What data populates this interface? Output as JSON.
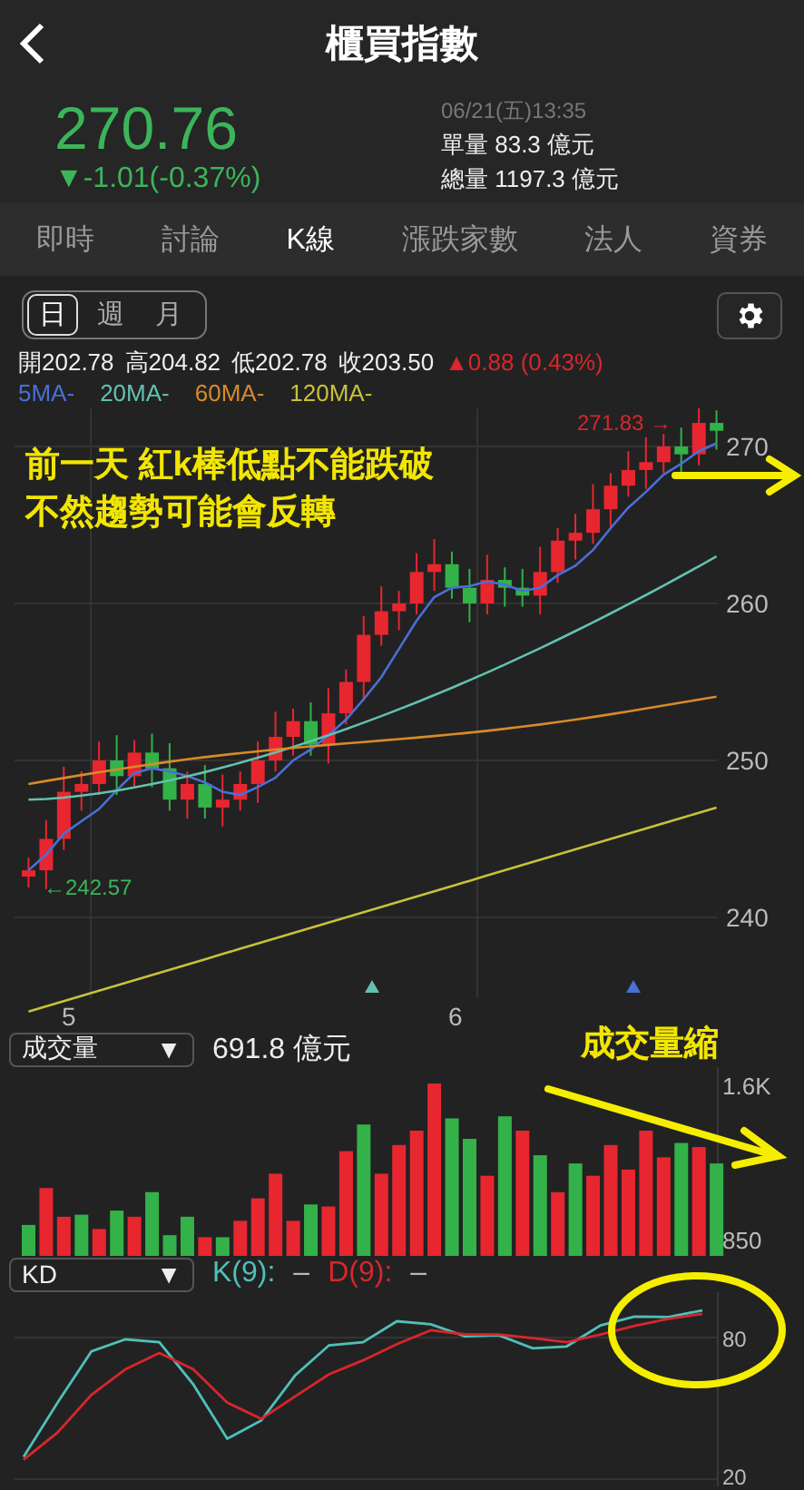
{
  "header": {
    "title": "櫃買指數"
  },
  "quote": {
    "price": "270.76",
    "change": "▼-1.01(-0.37%)",
    "time": "06/21(五)13:35",
    "volume_lines": [
      {
        "label": "單量",
        "value": "83.3 億元"
      },
      {
        "label": "總量",
        "value": "1197.3 億元"
      }
    ]
  },
  "tabs": [
    {
      "label": "即時",
      "selected": false
    },
    {
      "label": "討論",
      "selected": false
    },
    {
      "label": "K線",
      "selected": true
    },
    {
      "label": "漲跌家數",
      "selected": false
    },
    {
      "label": "法人",
      "selected": false
    },
    {
      "label": "資券",
      "selected": false
    }
  ],
  "periods": [
    {
      "label": "日",
      "selected": true
    },
    {
      "label": "週",
      "selected": false
    },
    {
      "label": "月",
      "selected": false
    }
  ],
  "ohlc": [
    {
      "label": "開",
      "value": "202.78"
    },
    {
      "label": "高",
      "value": "204.82"
    },
    {
      "label": "低",
      "value": "202.78"
    },
    {
      "label": "收",
      "value": "203.50"
    }
  ],
  "day_change": "▲0.88 (0.43%)",
  "ma_legend": [
    {
      "label": "5MA-",
      "color": "#4a6fd8"
    },
    {
      "label": "20MA-",
      "color": "#63c1b0"
    },
    {
      "label": "60MA-",
      "color": "#d88a2a"
    },
    {
      "label": "120MA-",
      "color": "#c9c13a"
    }
  ],
  "price_chart": {
    "high_label": "271.83 →",
    "low_label": "←242.57",
    "price_ticks": [
      "270",
      "260",
      "250",
      "240"
    ],
    "date_labels": [
      "5",
      "6"
    ]
  },
  "volume": {
    "selector": "成交量",
    "caret": "▼",
    "total": "691.8 億元",
    "chart_data": {
      "type": "bar",
      "stacked": true,
      "categories": [
        null,
        null,
        null,
        null,
        null,
        null,
        null,
        null,
        null,
        null,
        null,
        null,
        null,
        null,
        null,
        null,
        null,
        null,
        null,
        null,
        null,
        null,
        null,
        null,
        null,
        null,
        null,
        null,
        null,
        null,
        null,
        null,
        null,
        null,
        null,
        null,
        null,
        null,
        null,
        null
      ],
      "ylim": [
        769,
        1690
      ],
      "yticks": [
        {
          "value": 1600,
          "label": "1.6K"
        },
        {
          "value": 850,
          "label": "850"
        }
      ],
      "series": [
        {
          "color": "#e8262f",
          "values": [
            null,
            1100,
            960,
            null,
            900,
            null,
            960,
            null,
            null,
            null,
            860,
            null,
            940,
            1050,
            1170,
            940,
            null,
            1010,
            1280,
            null,
            1170,
            1310,
            1380,
            1610,
            null,
            null,
            1160,
            null,
            1380,
            null,
            1080,
            null,
            1160,
            1310,
            1190,
            1380,
            1250,
            null,
            1300,
            null
          ]
        },
        {
          "color": "#33b249",
          "values": [
            920,
            null,
            null,
            970,
            null,
            990,
            null,
            1080,
            870,
            960,
            null,
            860,
            null,
            null,
            null,
            null,
            1020,
            null,
            null,
            1410,
            null,
            null,
            null,
            null,
            1440,
            1340,
            null,
            1450,
            null,
            1260,
            null,
            1220,
            null,
            null,
            null,
            null,
            null,
            1320,
            null,
            1220
          ]
        }
      ]
    }
  },
  "kd": {
    "selector": "KD",
    "caret": "▼",
    "legend": [
      {
        "label": "K(9):",
        "value": "–",
        "color": "#4fc0b8"
      },
      {
        "label": "D(9):",
        "value": "–",
        "color": "#d8262c"
      }
    ],
    "chart_data": {
      "type": "line",
      "ylim": [
        16.9,
        99.2
      ],
      "yticks": [
        80,
        20
      ],
      "series": [
        {
          "color": "#4fc0b8",
          "values": [
            29.4,
            52.4,
            74.1,
            79.2,
            78.0,
            60.1,
            37.1,
            44.8,
            63.9,
            76.7,
            78.0,
            86.9,
            85.6,
            80.5,
            81.0,
            75.4,
            76.2,
            85.1,
            88.9,
            88.7,
            91.5
          ]
        },
        {
          "color": "#d8262c",
          "values": [
            28.2,
            39.7,
            55.7,
            66.5,
            73.4,
            66.5,
            52.4,
            45.5,
            55.0,
            64.4,
            70.3,
            77.2,
            83.1,
            81.3,
            81.3,
            79.7,
            78.0,
            81.3,
            84.9,
            87.9,
            90.0
          ]
        }
      ]
    }
  },
  "annotations": [
    {
      "text": "前一天 紅k棒低點不能跌破"
    },
    {
      "text": "不然趨勢可能會反轉"
    },
    {
      "text": "成交量縮"
    }
  ]
}
